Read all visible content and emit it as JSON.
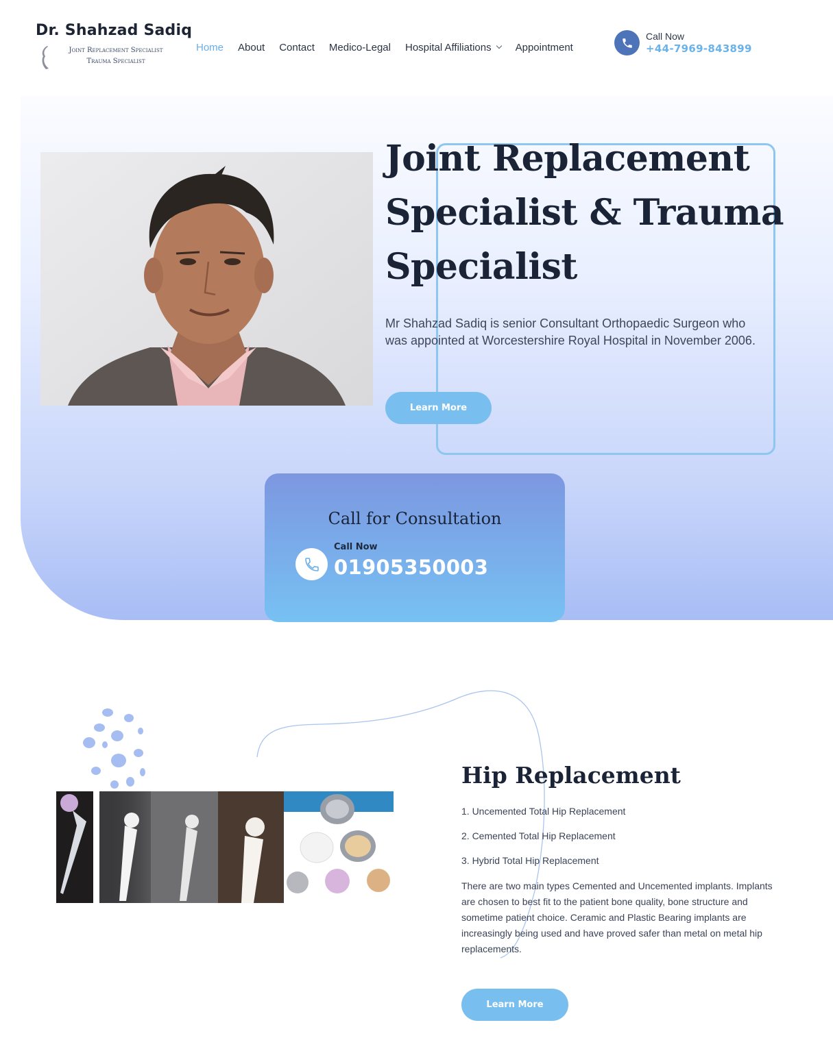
{
  "brand": {
    "name": "Dr. Shahzad Sadiq",
    "tagline_line1": "Joint Replacement Specialist",
    "tagline_line2": "Trauma Specialist"
  },
  "nav": {
    "items": [
      {
        "label": "Home",
        "active": true
      },
      {
        "label": "About"
      },
      {
        "label": "Contact"
      },
      {
        "label": "Medico-Legal"
      },
      {
        "label": "Hospital Affiliations",
        "has_dropdown": true
      },
      {
        "label": "Appointment"
      }
    ]
  },
  "header_call": {
    "label": "Call Now",
    "number": "+44-7969-843899",
    "icon": "phone-icon"
  },
  "hero": {
    "title": "Joint Replacement Specialist & Trauma Specialist",
    "description": "Mr Shahzad Sadiq is senior Consultant Orthopaedic Surgeon who was appointed at Worcestershire Royal Hospital in November 2006.",
    "button_label": "Learn More"
  },
  "consultation": {
    "title": "Call for Consultation",
    "label": "Call Now",
    "number": "01905350003",
    "icon": "phone-icon"
  },
  "hip": {
    "title": "Hip Replacement",
    "list": [
      "1. Uncemented Total Hip Replacement",
      "2. Cemented Total Hip Replacement",
      "3. Hybrid Total Hip Replacement"
    ],
    "description": "There are two main types Cemented and Uncemented implants. Implants are chosen to best fit to the patient bone quality, bone structure and sometime patient choice. Ceramic and Plastic Bearing implants are increasingly being used and have proved safer than metal on metal hip replacements.",
    "button_label": "Learn More"
  },
  "colors": {
    "accent": "#78bff0",
    "active_nav": "#6aaee8",
    "phone_circle": "#4d74b8",
    "frame_border": "#8ec6f2"
  }
}
